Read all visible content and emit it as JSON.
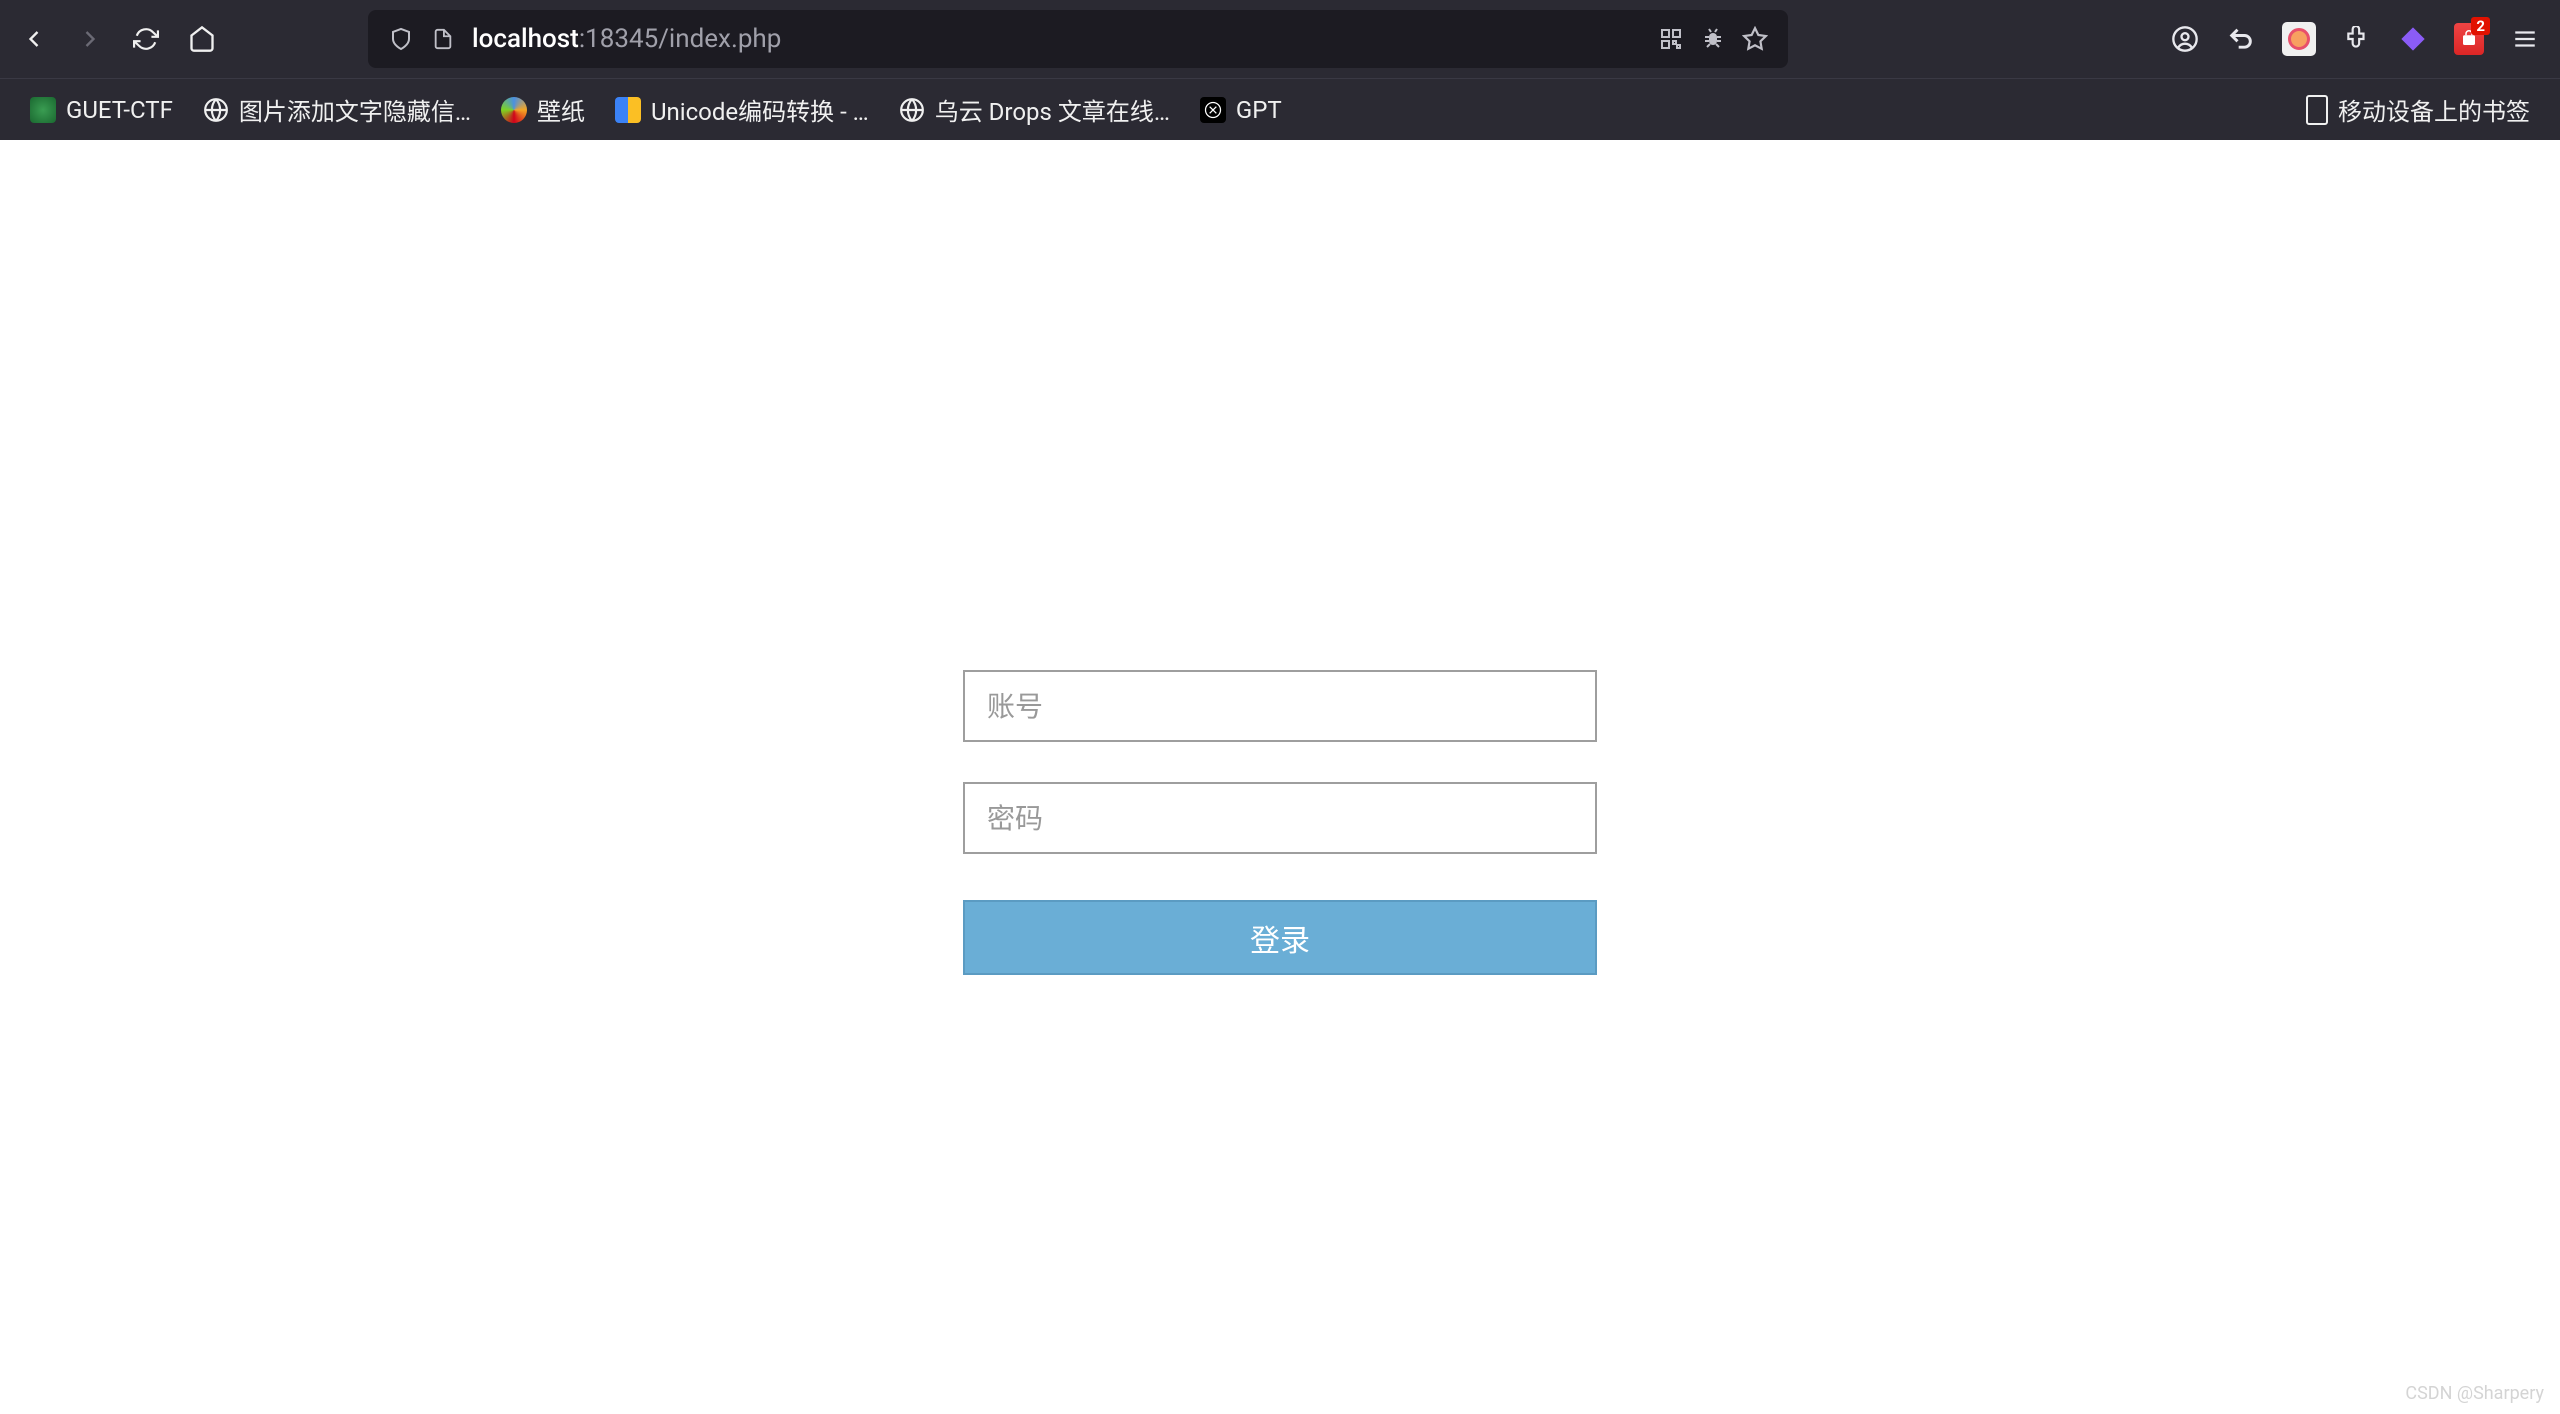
{
  "browser": {
    "url_host": "localhost",
    "url_port_path": ":18345/index.php",
    "ext_badge": "2"
  },
  "bookmarks": {
    "items": [
      "GUET-CTF",
      "图片添加文字隐藏信…",
      "壁纸",
      "Unicode编码转换 - …",
      "乌云 Drops 文章在线…",
      "GPT"
    ],
    "mobile": "移动设备上的书签"
  },
  "login": {
    "username_placeholder": "账号",
    "password_placeholder": "密码",
    "submit_label": "登录"
  },
  "watermark": "CSDN @Sharpery"
}
